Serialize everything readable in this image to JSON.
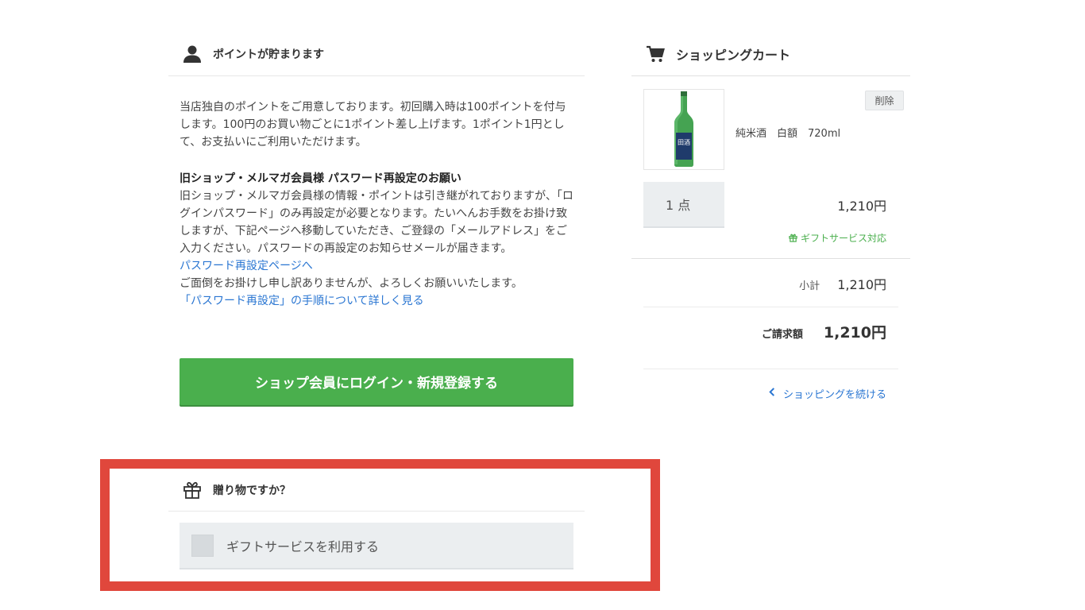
{
  "points": {
    "title": "ポイントが貯まります",
    "intro": "当店独自のポイントをご用意しております。初回購入時は100ポイントを付与します。100円のお買い物ごとに1ポイント差し上げます。1ポイント1円として、お支払いにご利用いただけます。",
    "notice_title": "旧ショップ・メルマガ会員様 パスワード再設定のお願い",
    "notice_body": "旧ショップ・メルマガ会員様の情報・ポイントは引き継がれておりますが、「ログインパスワード」のみ再設定が必要となります。たいへんお手数をお掛け致しますが、下記ページへ移動していただき、ご登録の「メールアドレス」をご入力ください。パスワードの再設定のお知らせメールが届きます。",
    "reset_link": "パスワード再設定ページへ",
    "apology": "ご面倒をお掛けし申し訳ありませんが、よろしくお願いいたします。",
    "howto_link": "「パスワード再設定」の手順について詳しく見る",
    "login_button": "ショップ会員にログイン・新規登録する"
  },
  "gift": {
    "title": "贈り物ですか？",
    "option_label": "ギフトサービスを利用する",
    "checked": false,
    "highlight_color": "#e0473c"
  },
  "cart": {
    "title": "ショッピングカート",
    "item": {
      "name": "純米酒　白額　720ml",
      "label_text": "田酒",
      "delete_label": "削除",
      "quantity": "1 点",
      "price": "1,210円",
      "gift_note": "ギフトサービス対応"
    },
    "subtotal_label": "小計",
    "subtotal_value": "1,210円",
    "total_label": "ご請求額",
    "total_value": "1,210円",
    "continue_label": "ショッピングを続ける"
  },
  "colors": {
    "accent_green": "#4aaf4d",
    "link_blue": "#2a76d2"
  }
}
